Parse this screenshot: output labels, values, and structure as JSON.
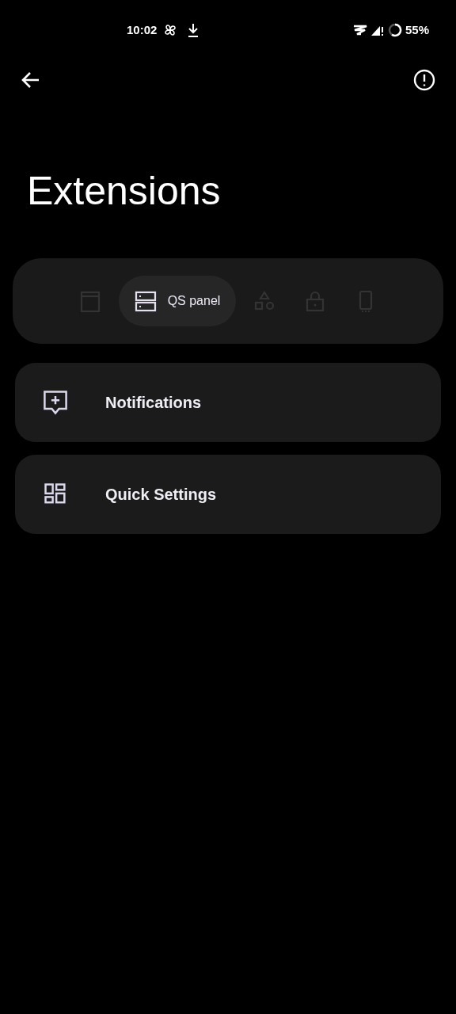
{
  "status_bar": {
    "time": "10:02",
    "battery": "55%"
  },
  "title": "Extensions",
  "tabs": [
    {
      "kind": "header",
      "selected": false
    },
    {
      "kind": "panel",
      "label": "QS panel",
      "selected": true
    },
    {
      "kind": "shapes",
      "selected": false
    },
    {
      "kind": "lock",
      "selected": false
    },
    {
      "kind": "phone",
      "selected": false
    }
  ],
  "items": [
    {
      "kind": "notifications",
      "label": "Notifications"
    },
    {
      "kind": "tiles",
      "label": "Quick Settings"
    }
  ]
}
